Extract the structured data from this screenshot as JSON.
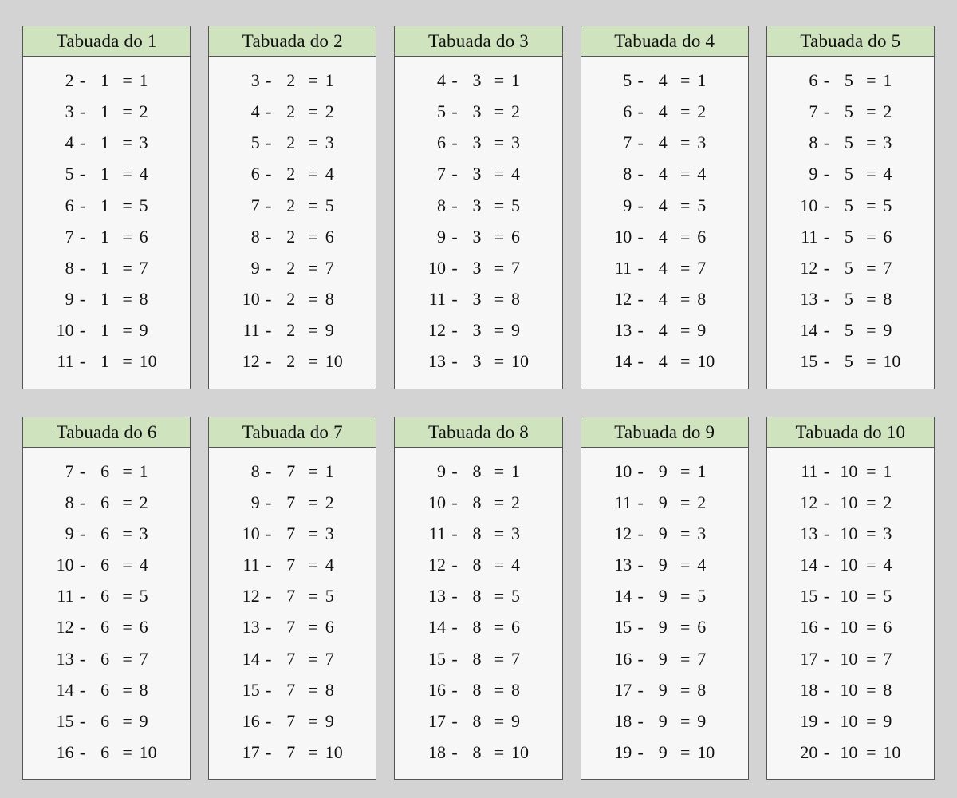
{
  "title_prefix": "Tabuada do",
  "operator": "-",
  "equals": "=",
  "tables": [
    {
      "n": 1,
      "rows": [
        {
          "a": 2,
          "b": 1,
          "r": 1
        },
        {
          "a": 3,
          "b": 1,
          "r": 2
        },
        {
          "a": 4,
          "b": 1,
          "r": 3
        },
        {
          "a": 5,
          "b": 1,
          "r": 4
        },
        {
          "a": 6,
          "b": 1,
          "r": 5
        },
        {
          "a": 7,
          "b": 1,
          "r": 6
        },
        {
          "a": 8,
          "b": 1,
          "r": 7
        },
        {
          "a": 9,
          "b": 1,
          "r": 8
        },
        {
          "a": 10,
          "b": 1,
          "r": 9
        },
        {
          "a": 11,
          "b": 1,
          "r": 10
        }
      ]
    },
    {
      "n": 2,
      "rows": [
        {
          "a": 3,
          "b": 2,
          "r": 1
        },
        {
          "a": 4,
          "b": 2,
          "r": 2
        },
        {
          "a": 5,
          "b": 2,
          "r": 3
        },
        {
          "a": 6,
          "b": 2,
          "r": 4
        },
        {
          "a": 7,
          "b": 2,
          "r": 5
        },
        {
          "a": 8,
          "b": 2,
          "r": 6
        },
        {
          "a": 9,
          "b": 2,
          "r": 7
        },
        {
          "a": 10,
          "b": 2,
          "r": 8
        },
        {
          "a": 11,
          "b": 2,
          "r": 9
        },
        {
          "a": 12,
          "b": 2,
          "r": 10
        }
      ]
    },
    {
      "n": 3,
      "rows": [
        {
          "a": 4,
          "b": 3,
          "r": 1
        },
        {
          "a": 5,
          "b": 3,
          "r": 2
        },
        {
          "a": 6,
          "b": 3,
          "r": 3
        },
        {
          "a": 7,
          "b": 3,
          "r": 4
        },
        {
          "a": 8,
          "b": 3,
          "r": 5
        },
        {
          "a": 9,
          "b": 3,
          "r": 6
        },
        {
          "a": 10,
          "b": 3,
          "r": 7
        },
        {
          "a": 11,
          "b": 3,
          "r": 8
        },
        {
          "a": 12,
          "b": 3,
          "r": 9
        },
        {
          "a": 13,
          "b": 3,
          "r": 10
        }
      ]
    },
    {
      "n": 4,
      "rows": [
        {
          "a": 5,
          "b": 4,
          "r": 1
        },
        {
          "a": 6,
          "b": 4,
          "r": 2
        },
        {
          "a": 7,
          "b": 4,
          "r": 3
        },
        {
          "a": 8,
          "b": 4,
          "r": 4
        },
        {
          "a": 9,
          "b": 4,
          "r": 5
        },
        {
          "a": 10,
          "b": 4,
          "r": 6
        },
        {
          "a": 11,
          "b": 4,
          "r": 7
        },
        {
          "a": 12,
          "b": 4,
          "r": 8
        },
        {
          "a": 13,
          "b": 4,
          "r": 9
        },
        {
          "a": 14,
          "b": 4,
          "r": 10
        }
      ]
    },
    {
      "n": 5,
      "rows": [
        {
          "a": 6,
          "b": 5,
          "r": 1
        },
        {
          "a": 7,
          "b": 5,
          "r": 2
        },
        {
          "a": 8,
          "b": 5,
          "r": 3
        },
        {
          "a": 9,
          "b": 5,
          "r": 4
        },
        {
          "a": 10,
          "b": 5,
          "r": 5
        },
        {
          "a": 11,
          "b": 5,
          "r": 6
        },
        {
          "a": 12,
          "b": 5,
          "r": 7
        },
        {
          "a": 13,
          "b": 5,
          "r": 8
        },
        {
          "a": 14,
          "b": 5,
          "r": 9
        },
        {
          "a": 15,
          "b": 5,
          "r": 10
        }
      ]
    },
    {
      "n": 6,
      "rows": [
        {
          "a": 7,
          "b": 6,
          "r": 1
        },
        {
          "a": 8,
          "b": 6,
          "r": 2
        },
        {
          "a": 9,
          "b": 6,
          "r": 3
        },
        {
          "a": 10,
          "b": 6,
          "r": 4
        },
        {
          "a": 11,
          "b": 6,
          "r": 5
        },
        {
          "a": 12,
          "b": 6,
          "r": 6
        },
        {
          "a": 13,
          "b": 6,
          "r": 7
        },
        {
          "a": 14,
          "b": 6,
          "r": 8
        },
        {
          "a": 15,
          "b": 6,
          "r": 9
        },
        {
          "a": 16,
          "b": 6,
          "r": 10
        }
      ]
    },
    {
      "n": 7,
      "rows": [
        {
          "a": 8,
          "b": 7,
          "r": 1
        },
        {
          "a": 9,
          "b": 7,
          "r": 2
        },
        {
          "a": 10,
          "b": 7,
          "r": 3
        },
        {
          "a": 11,
          "b": 7,
          "r": 4
        },
        {
          "a": 12,
          "b": 7,
          "r": 5
        },
        {
          "a": 13,
          "b": 7,
          "r": 6
        },
        {
          "a": 14,
          "b": 7,
          "r": 7
        },
        {
          "a": 15,
          "b": 7,
          "r": 8
        },
        {
          "a": 16,
          "b": 7,
          "r": 9
        },
        {
          "a": 17,
          "b": 7,
          "r": 10
        }
      ]
    },
    {
      "n": 8,
      "rows": [
        {
          "a": 9,
          "b": 8,
          "r": 1
        },
        {
          "a": 10,
          "b": 8,
          "r": 2
        },
        {
          "a": 11,
          "b": 8,
          "r": 3
        },
        {
          "a": 12,
          "b": 8,
          "r": 4
        },
        {
          "a": 13,
          "b": 8,
          "r": 5
        },
        {
          "a": 14,
          "b": 8,
          "r": 6
        },
        {
          "a": 15,
          "b": 8,
          "r": 7
        },
        {
          "a": 16,
          "b": 8,
          "r": 8
        },
        {
          "a": 17,
          "b": 8,
          "r": 9
        },
        {
          "a": 18,
          "b": 8,
          "r": 10
        }
      ]
    },
    {
      "n": 9,
      "rows": [
        {
          "a": 10,
          "b": 9,
          "r": 1
        },
        {
          "a": 11,
          "b": 9,
          "r": 2
        },
        {
          "a": 12,
          "b": 9,
          "r": 3
        },
        {
          "a": 13,
          "b": 9,
          "r": 4
        },
        {
          "a": 14,
          "b": 9,
          "r": 5
        },
        {
          "a": 15,
          "b": 9,
          "r": 6
        },
        {
          "a": 16,
          "b": 9,
          "r": 7
        },
        {
          "a": 17,
          "b": 9,
          "r": 8
        },
        {
          "a": 18,
          "b": 9,
          "r": 9
        },
        {
          "a": 19,
          "b": 9,
          "r": 10
        }
      ]
    },
    {
      "n": 10,
      "rows": [
        {
          "a": 11,
          "b": 10,
          "r": 1
        },
        {
          "a": 12,
          "b": 10,
          "r": 2
        },
        {
          "a": 13,
          "b": 10,
          "r": 3
        },
        {
          "a": 14,
          "b": 10,
          "r": 4
        },
        {
          "a": 15,
          "b": 10,
          "r": 5
        },
        {
          "a": 16,
          "b": 10,
          "r": 6
        },
        {
          "a": 17,
          "b": 10,
          "r": 7
        },
        {
          "a": 18,
          "b": 10,
          "r": 8
        },
        {
          "a": 19,
          "b": 10,
          "r": 9
        },
        {
          "a": 20,
          "b": 10,
          "r": 10
        }
      ]
    }
  ]
}
